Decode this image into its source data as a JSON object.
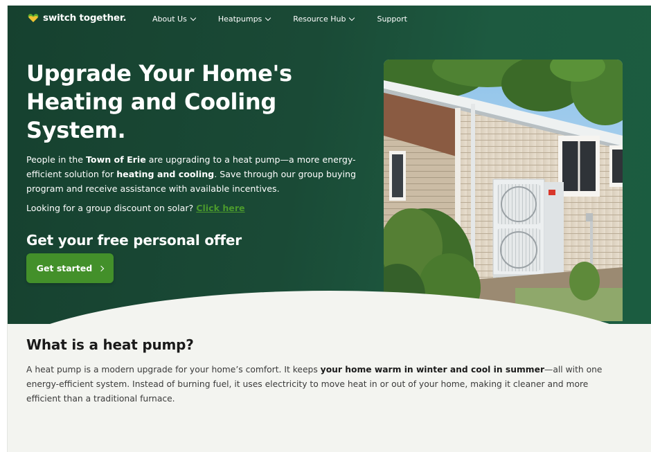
{
  "brand": {
    "name": "switch together."
  },
  "nav": {
    "items": [
      {
        "label": "About Us",
        "has_dropdown": true
      },
      {
        "label": "Heatpumps",
        "has_dropdown": true
      },
      {
        "label": "Resource Hub",
        "has_dropdown": true
      },
      {
        "label": "Support",
        "has_dropdown": false
      }
    ]
  },
  "hero": {
    "title": "Upgrade Your Home's Heating and Cooling System.",
    "desc_part1": "People in the ",
    "desc_town": "Town of Erie",
    "desc_part2": " are upgrading to a heat pump—a more energy-efficient solution for ",
    "desc_bold": "heating and cooling",
    "desc_part3": ". Save through our group buying program and receive assistance with available incentives.",
    "solar_text": "Looking for a group discount on solar? ",
    "solar_link": "Click here",
    "offer_title": "Get your free personal offer",
    "cta_label": "Get started"
  },
  "info": {
    "title": "What is a heat pump?",
    "body_part1": "A heat pump is a modern upgrade for your home’s comfort. It keeps ",
    "body_bold": "your home warm in winter and cool in summer",
    "body_part2": "—all with one energy-efficient system. Instead of burning fuel, it uses electricity to move heat in or out of your home, making it cleaner and more efficient than a traditional furnace."
  },
  "colors": {
    "hero_bg": "#1a4a36",
    "accent_green": "#43902a",
    "link_green": "#4b9a2c",
    "section_bg": "#f3f4f0"
  },
  "icons": [
    "heart-leaf-logo-icon",
    "chevron-down-icon",
    "chevron-right-icon"
  ]
}
